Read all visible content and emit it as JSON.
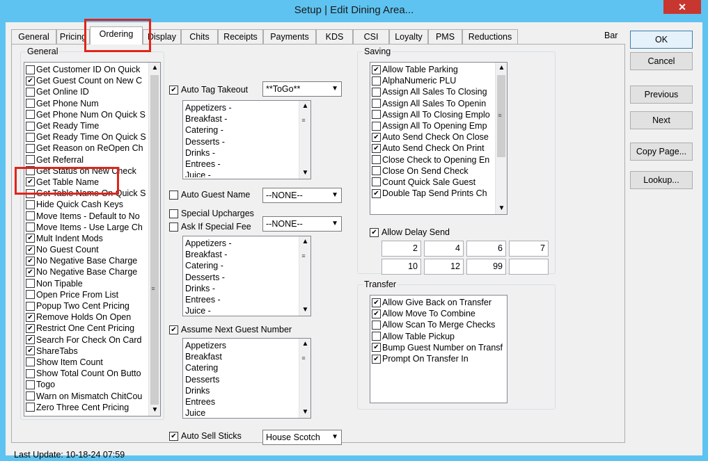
{
  "window": {
    "title": "Setup | Edit Dining Area...",
    "close_glyph": "✕"
  },
  "tabs": [
    "General",
    "Pricing",
    "Ordering",
    "Display",
    "Chits",
    "Receipts",
    "Payments",
    "KDS",
    "CSI",
    "Loyalty",
    "PMS",
    "Reductions"
  ],
  "active_tab": "Ordering",
  "bar_label": "Bar",
  "buttons": {
    "ok": "OK",
    "cancel": "Cancel",
    "previous": "Previous",
    "next": "Next",
    "copy_page": "Copy Page...",
    "lookup": "Lookup..."
  },
  "general": {
    "title": "General",
    "items": [
      {
        "label": "Get Customer ID On Quick",
        "checked": false
      },
      {
        "label": "Get Guest Count on New C",
        "checked": true
      },
      {
        "label": "Get Online ID",
        "checked": false
      },
      {
        "label": "Get Phone Num",
        "checked": false
      },
      {
        "label": "Get Phone Num On Quick S",
        "checked": false
      },
      {
        "label": "Get Ready Time",
        "checked": false
      },
      {
        "label": "Get Ready Time On Quick S",
        "checked": false
      },
      {
        "label": "Get Reason on ReOpen Ch",
        "checked": false
      },
      {
        "label": "Get Referral",
        "checked": false
      },
      {
        "label": "Get Status on New Check",
        "checked": false
      },
      {
        "label": "Get Table Name",
        "checked": true
      },
      {
        "label": "Get Table Name On Quick S",
        "checked": false
      },
      {
        "label": "Hide Quick Cash Keys",
        "checked": false
      },
      {
        "label": "Move Items - Default to No",
        "checked": false
      },
      {
        "label": "Move Items - Use Large Ch",
        "checked": false
      },
      {
        "label": "Mult Indent Mods",
        "checked": true
      },
      {
        "label": "No Guest Count",
        "checked": true
      },
      {
        "label": "No Negative Base Charge",
        "checked": true
      },
      {
        "label": "No Negative Base Charge",
        "checked": true
      },
      {
        "label": "Non Tipable",
        "checked": false
      },
      {
        "label": "Open Price From List",
        "checked": false
      },
      {
        "label": "Popup Two Cent Pricing",
        "checked": false
      },
      {
        "label": "Remove Holds On Open",
        "checked": true
      },
      {
        "label": "Restrict One Cent Pricing",
        "checked": true
      },
      {
        "label": "Search For Check On Card",
        "checked": true
      },
      {
        "label": "ShareTabs",
        "checked": true
      },
      {
        "label": "Show Item Count",
        "checked": false
      },
      {
        "label": "Show Total Count On Butto",
        "checked": false
      },
      {
        "label": "Togo",
        "checked": false
      },
      {
        "label": "Warn on Mismatch ChitCou",
        "checked": false
      },
      {
        "label": "Zero Three Cent Pricing",
        "checked": false
      }
    ]
  },
  "auto_tag_takeout": {
    "label": "Auto Tag Takeout",
    "checked": true,
    "combo_value": "**ToGo**"
  },
  "list_dash": [
    "Appetizers -",
    "Breakfast -",
    "Catering -",
    "Desserts -",
    "Drinks -",
    "Entrees -",
    "Juice -"
  ],
  "auto_guest_name": {
    "label": "Auto Guest Name",
    "checked": false,
    "combo_value": "--NONE--"
  },
  "special_upcharges": {
    "label": "Special Upcharges",
    "checked": false
  },
  "ask_if_special_fee": {
    "label": "Ask If Special Fee",
    "checked": false,
    "combo_value": "--NONE--"
  },
  "assume_next_guest": {
    "label": "Assume Next Guest Number",
    "checked": true
  },
  "list_plain": [
    "Appetizers",
    "Breakfast",
    "Catering",
    "Desserts",
    "Drinks",
    "Entrees",
    "Juice"
  ],
  "auto_sell_sticks": {
    "label": "Auto Sell Sticks",
    "checked": true,
    "combo_value": "House Scotch"
  },
  "saving": {
    "title": "Saving",
    "items": [
      {
        "label": "Allow Table Parking",
        "checked": true
      },
      {
        "label": "AlphaNumeric PLU",
        "checked": false
      },
      {
        "label": "Assign All Sales To Closing",
        "checked": false
      },
      {
        "label": "Assign All Sales To Openin",
        "checked": false
      },
      {
        "label": "Assign All To Closing Emplo",
        "checked": false
      },
      {
        "label": "Assign All To Opening Emp",
        "checked": false
      },
      {
        "label": "Auto Send Check On Close",
        "checked": true
      },
      {
        "label": "Auto Send Check On Print",
        "checked": true
      },
      {
        "label": "Close Check to Opening En",
        "checked": false
      },
      {
        "label": "Close On Send Check",
        "checked": false
      },
      {
        "label": "Count Quick Sale Guest",
        "checked": false
      },
      {
        "label": "Double Tap Send Prints Ch",
        "checked": true
      }
    ]
  },
  "allow_delay_send": {
    "label": "Allow Delay Send",
    "checked": true,
    "values": [
      "2",
      "4",
      "6",
      "7",
      "10",
      "12",
      "99",
      ""
    ]
  },
  "transfer": {
    "title": "Transfer",
    "items": [
      {
        "label": "Allow Give Back on Transfer",
        "checked": true
      },
      {
        "label": "Allow Move To Combine",
        "checked": true
      },
      {
        "label": "Allow Scan To Merge Checks",
        "checked": false
      },
      {
        "label": "Allow Table Pickup",
        "checked": false
      },
      {
        "label": "Bump Guest Number on Transf",
        "checked": true
      },
      {
        "label": "Prompt On Transfer In",
        "checked": true
      }
    ]
  },
  "status_bar": {
    "last_update": "Last Update:  10-18-24 07:59"
  }
}
